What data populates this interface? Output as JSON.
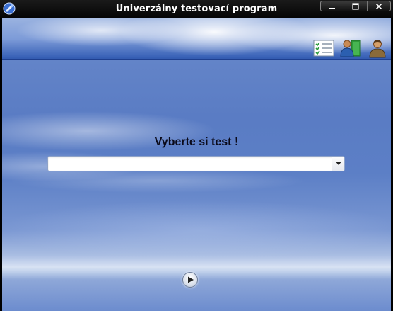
{
  "window": {
    "title": "Univerzálny testovací program",
    "controls": {
      "minimize_icon": "minimize-icon",
      "maximize_icon": "maximize-icon",
      "close_icon": "close-icon"
    }
  },
  "toolbar": {
    "icons": [
      "checklist-icon",
      "user-book-icon",
      "user-icon"
    ]
  },
  "main": {
    "prompt": "Vyberte si test !",
    "test_select": {
      "value": "",
      "dropdown_icon": "chevron-down-icon"
    },
    "start_button_icon": "play-icon"
  },
  "colors": {
    "title_bar": "#0a0a0a",
    "sky_blue": "#5a7cc4",
    "prompt_text": "#0a0a1a"
  }
}
